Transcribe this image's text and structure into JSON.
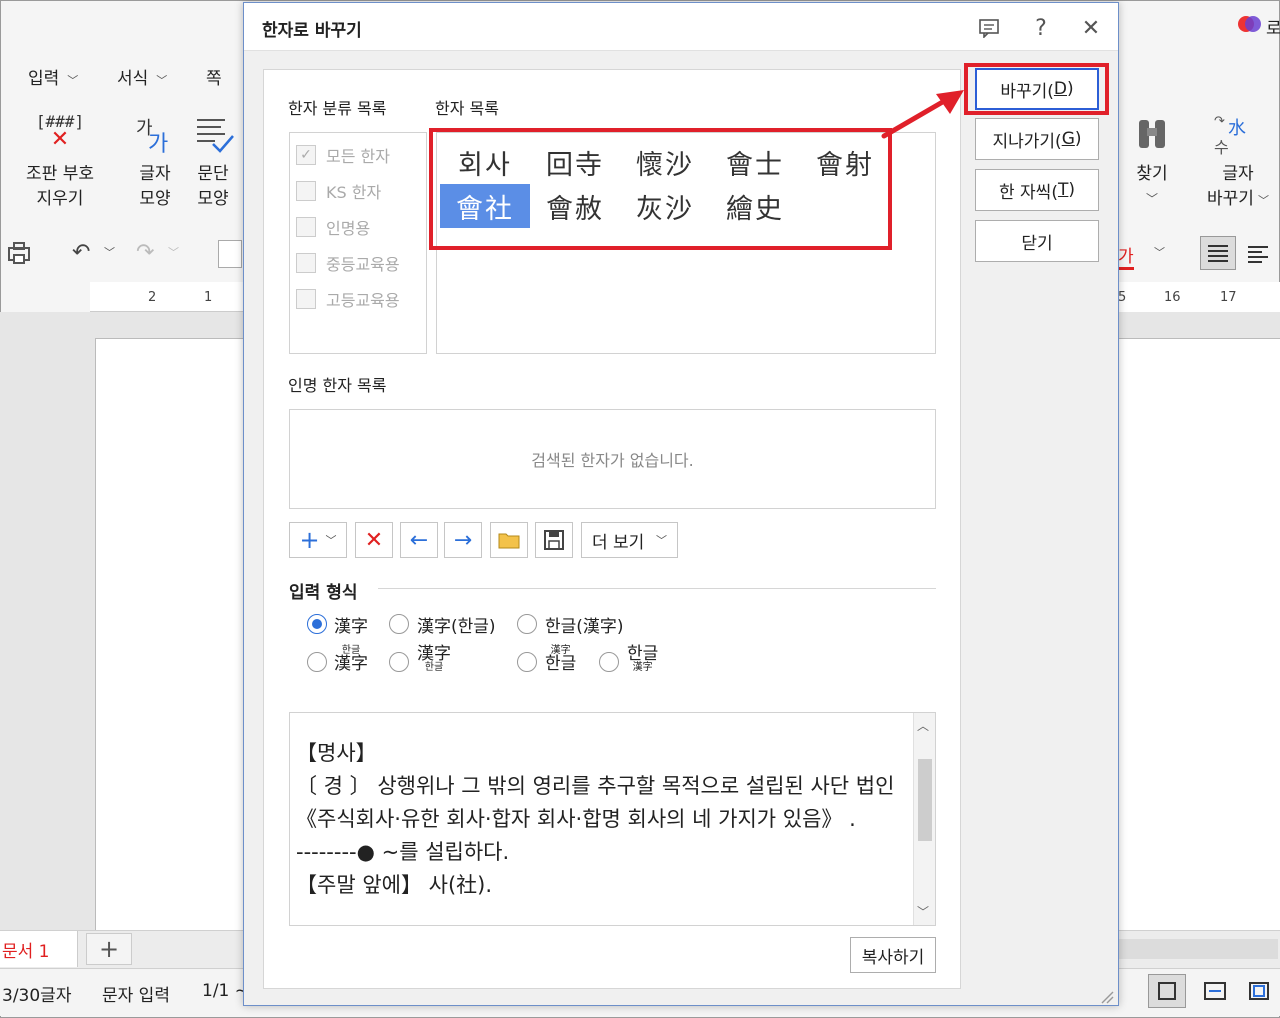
{
  "background_app": {
    "menus": [
      "입력",
      "서식",
      "쪽"
    ],
    "ribbon": {
      "clear_markup": [
        "조판 부호",
        "지우기"
      ],
      "char_shape": [
        "글자",
        "모양"
      ],
      "para_shape": [
        "문단",
        "모양"
      ],
      "find": [
        "찾기"
      ],
      "char_replace": [
        "글자",
        "바꾸기"
      ],
      "markup_glyph": "[###]",
      "ga_glyph": "가",
      "water_glyph": "水",
      "su_glyph": "수"
    },
    "ruler_numbers_left": [
      "2",
      "1"
    ],
    "ruler_numbers_right": [
      "5",
      "16",
      "17"
    ],
    "doc_tab": "문서 1",
    "add_tab": "+",
    "status": {
      "char_count": "3/30글자",
      "mode": "문자 입력",
      "page": "1/1 ~"
    },
    "brand_partial": "로"
  },
  "dialog": {
    "title": "한자로 바꾸기",
    "category_label": "한자 분류 목록",
    "hanja_list_label": "한자 목록",
    "categories": [
      {
        "label": "모든 한자",
        "checked": true
      },
      {
        "label": "KS 한자",
        "checked": false
      },
      {
        "label": "인명용",
        "checked": false
      },
      {
        "label": "중등교육용",
        "checked": false
      },
      {
        "label": "고등교육용",
        "checked": false
      }
    ],
    "hanja_candidates": [
      {
        "text": "회사",
        "selected": false
      },
      {
        "text": "回寺",
        "selected": false
      },
      {
        "text": "懷沙",
        "selected": false
      },
      {
        "text": "會士",
        "selected": false
      },
      {
        "text": "會射",
        "selected": false
      },
      {
        "text": "會社",
        "selected": true
      },
      {
        "text": "會赦",
        "selected": false
      },
      {
        "text": "灰沙",
        "selected": false
      },
      {
        "text": "繪史",
        "selected": false
      }
    ],
    "person_hanja_label": "인명 한자 목록",
    "person_hanja_empty": "검색된 한자가 없습니다.",
    "more_view": "더 보기",
    "input_format_label": "입력 형식",
    "formats_row1": [
      {
        "label": "漢字",
        "selected": true
      },
      {
        "label": "漢字(한글)",
        "selected": false
      },
      {
        "label": "한글(漢字)",
        "selected": false
      }
    ],
    "formats_row2": [
      {
        "top": "한글",
        "bottom": "漢字"
      },
      {
        "top": "漢字",
        "bottom": "한글"
      },
      {
        "top": "漢字",
        "bottom": "한글"
      },
      {
        "top": "한글",
        "bottom": "漢字"
      }
    ],
    "description": "【명사】\n〔 경 〕 상행위나 그 밖의 영리를 추구할 목적으로 설립된 사단 법인 《주식회사·유한 회사·합자 회사·합명 회사의 네 가지가 있음》 .\n--------● ~를 설립하다.\n【주말 앞에】 사(社).",
    "copy_button": "복사하기",
    "buttons": {
      "replace": {
        "text": "바꾸기(",
        "key": "D",
        "end": ")"
      },
      "skip": {
        "text": "지나가기(",
        "key": "G",
        "end": ")"
      },
      "one_by_one": {
        "text": "한 자씩(",
        "key": "T",
        "end": ")"
      },
      "close": "닫기"
    }
  },
  "colors": {
    "accent_blue": "#2c5ed6",
    "selection_blue": "#5b8ee6",
    "annotation_red": "#e0202a"
  }
}
